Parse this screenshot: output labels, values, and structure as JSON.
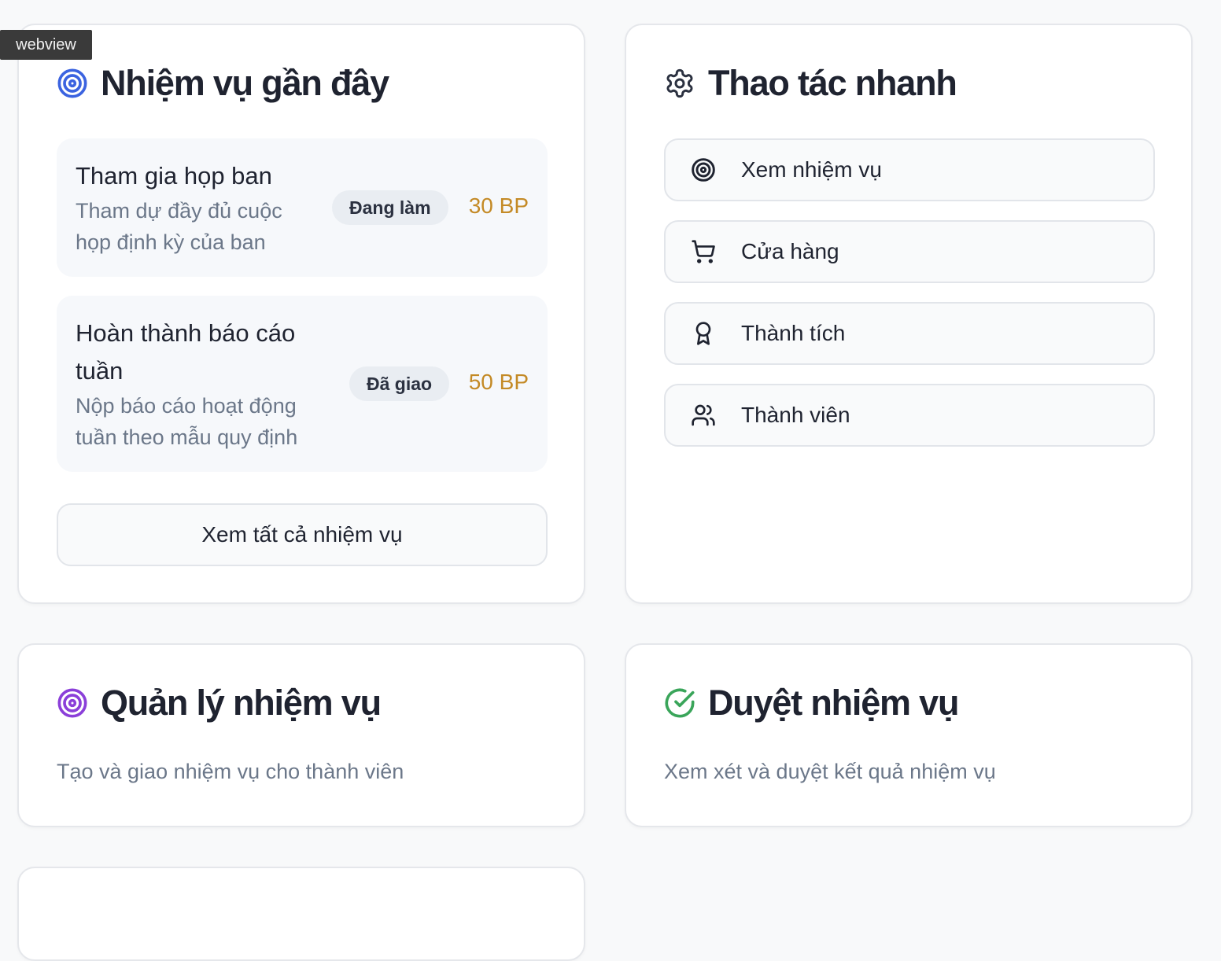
{
  "webview_tag": "webview",
  "recent_tasks": {
    "title": "Nhiệm vụ gần đây",
    "items": [
      {
        "name": "Tham gia họp ban",
        "desc_line1": "Tham dự đầy đủ cuộc",
        "desc_line2": "họp định kỳ của ban",
        "status": "Đang làm",
        "points": "30 BP"
      },
      {
        "name_line1": "Hoàn thành báo cáo",
        "name_line2": "tuần",
        "desc_line1": "Nộp báo cáo hoạt động",
        "desc_line2": "tuần theo mẫu quy định",
        "status": "Đã giao",
        "points": "50 BP"
      }
    ],
    "view_all_label": "Xem tất cả nhiệm vụ"
  },
  "quick_actions": {
    "title": "Thao tác nhanh",
    "items": [
      {
        "label": "Xem nhiệm vụ",
        "icon": "target-icon"
      },
      {
        "label": "Cửa hàng",
        "icon": "cart-icon"
      },
      {
        "label": "Thành tích",
        "icon": "award-icon"
      },
      {
        "label": "Thành viên",
        "icon": "users-icon"
      }
    ]
  },
  "manage_tasks": {
    "title": "Quản lý nhiệm vụ",
    "desc": "Tạo và giao nhiệm vụ cho thành viên"
  },
  "review_tasks": {
    "title": "Duyệt nhiệm vụ",
    "desc": "Xem xét và duyệt kết quả nhiệm vụ"
  },
  "colors": {
    "accent_blue": "#3b63e0",
    "accent_purple": "#8b3fd9",
    "accent_green": "#3aa55a",
    "points_gold": "#c48a26"
  }
}
